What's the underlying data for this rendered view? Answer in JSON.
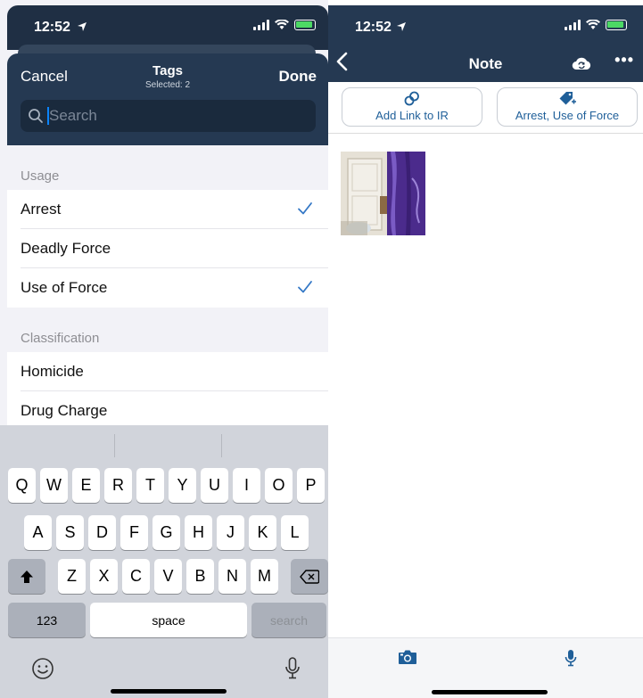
{
  "left_status": {
    "time": "12:52"
  },
  "tags_sheet": {
    "cancel_label": "Cancel",
    "title": "Tags",
    "subtitle": "Selected: 2",
    "done_label": "Done",
    "search_placeholder": "Search",
    "sections": [
      {
        "header": "Usage",
        "items": [
          {
            "label": "Arrest",
            "checked": true
          },
          {
            "label": "Deadly Force",
            "checked": false
          },
          {
            "label": "Use of Force",
            "checked": true
          }
        ]
      },
      {
        "header": "Classification",
        "items": [
          {
            "label": "Homicide",
            "checked": false
          },
          {
            "label": "Drug Charge",
            "checked": false
          }
        ]
      }
    ]
  },
  "keyboard": {
    "row1": [
      "Q",
      "W",
      "E",
      "R",
      "T",
      "Y",
      "U",
      "I",
      "O",
      "P"
    ],
    "row2": [
      "A",
      "S",
      "D",
      "F",
      "G",
      "H",
      "J",
      "K",
      "L"
    ],
    "row3": [
      "Z",
      "X",
      "C",
      "V",
      "B",
      "N",
      "M"
    ],
    "numbers_label": "123",
    "space_label": "space",
    "search_label": "search"
  },
  "right_status": {
    "time": "12:52"
  },
  "note_screen": {
    "title": "Note",
    "add_link_label": "Add Link to IR",
    "tags_summary_label": "Arrest, Use of Force"
  },
  "colors": {
    "nav_bg": "#253952",
    "accent_blue": "#1f5f99",
    "check_blue": "#3478c6"
  }
}
